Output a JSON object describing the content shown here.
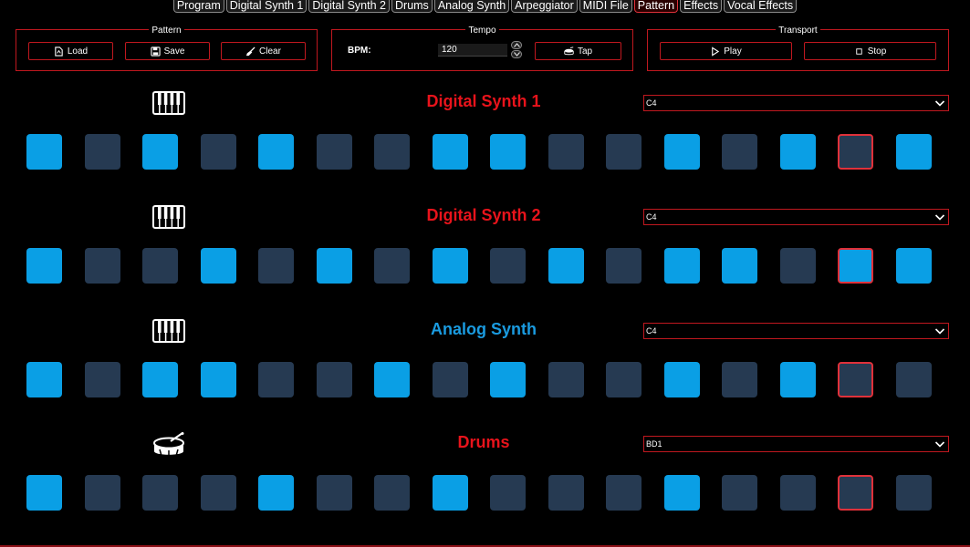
{
  "tabs": [
    {
      "label": "Program",
      "active": false
    },
    {
      "label": "Digital Synth 1",
      "active": false
    },
    {
      "label": "Digital Synth 2",
      "active": false
    },
    {
      "label": "Drums",
      "active": false
    },
    {
      "label": "Analog Synth",
      "active": false
    },
    {
      "label": "Arpeggiator",
      "active": false
    },
    {
      "label": "MIDI File",
      "active": false
    },
    {
      "label": "Pattern",
      "active": true
    },
    {
      "label": "Effects",
      "active": false
    },
    {
      "label": "Vocal Effects",
      "active": false
    }
  ],
  "pattern": {
    "title": "Pattern",
    "load": "Load",
    "save": "Save",
    "clear": "Clear"
  },
  "tempo": {
    "title": "Tempo",
    "bpm_label": "BPM:",
    "bpm_value": "120",
    "tap": "Tap"
  },
  "transport": {
    "title": "Transport",
    "play": "Play",
    "stop": "Stop"
  },
  "colors": {
    "accent": "#c0181f",
    "step_on": "#0a9fe5",
    "step_off": "#263a52",
    "title_red": "#e8131b",
    "title_blue": "#1a9be0"
  },
  "tracks": [
    {
      "title": "Digital Synth 1",
      "color": "#e8131b",
      "icon": "piano-icon",
      "note": "C4",
      "steps": [
        1,
        0,
        1,
        0,
        1,
        0,
        0,
        1,
        1,
        0,
        0,
        1,
        0,
        1,
        0,
        1
      ]
    },
    {
      "title": "Digital Synth 2",
      "color": "#e8131b",
      "icon": "piano-icon",
      "note": "C4",
      "steps": [
        1,
        0,
        0,
        1,
        0,
        1,
        0,
        1,
        0,
        1,
        0,
        1,
        1,
        0,
        1,
        1
      ]
    },
    {
      "title": "Analog Synth",
      "color": "#1a9be0",
      "icon": "piano-icon",
      "note": "C4",
      "steps": [
        1,
        0,
        1,
        1,
        0,
        0,
        1,
        0,
        1,
        0,
        0,
        1,
        0,
        1,
        0,
        0
      ]
    },
    {
      "title": "Drums",
      "color": "#e8131b",
      "icon": "drum-icon",
      "note": "BD1",
      "steps": [
        1,
        0,
        0,
        0,
        1,
        0,
        0,
        1,
        0,
        0,
        0,
        1,
        0,
        0,
        0,
        0
      ]
    }
  ],
  "current_step": 15
}
